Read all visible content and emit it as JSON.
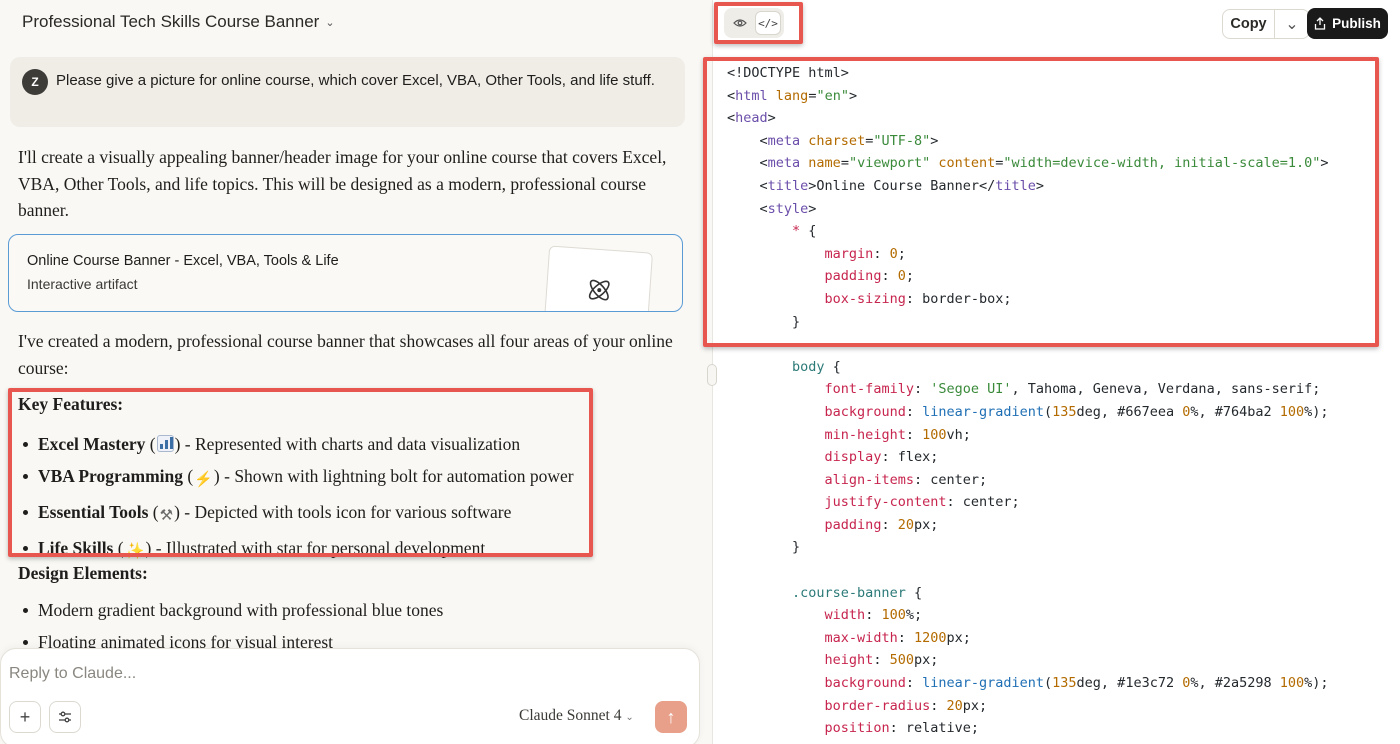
{
  "chat": {
    "title": "Professional Tech Skills Course Banner",
    "user_initial": "Z",
    "user_message": "Please give a picture for online course, which cover Excel, VBA, Other Tools, and life stuff.",
    "intro": "I'll create a visually appealing banner/header image for your online course that covers Excel, VBA, Other Tools, and life topics. This will be designed as a modern, professional course banner.",
    "artifact": {
      "title": "Online Course Banner - Excel, VBA, Tools & Life",
      "subtitle": "Interactive artifact",
      "icon": "atom-icon"
    },
    "summary": "I've created a modern, professional course banner that showcases all four areas of your online course:",
    "key_features_heading": "Key Features:",
    "features": [
      {
        "name": "Excel Mastery",
        "open": " (",
        "icon": "bar-chart-emoji",
        "rest": ") - Represented with charts and data visualization"
      },
      {
        "name": "VBA Programming",
        "open": " (",
        "icon": "lightning-emoji",
        "glyph": "⚡",
        "rest": ") - Shown with lightning bolt for automation power"
      },
      {
        "name": "Essential Tools",
        "open": " (",
        "icon": "tools-emoji",
        "glyph": "⚒",
        "rest": ") - Depicted with tools icon for various software"
      },
      {
        "name": "Life Skills",
        "open": " (",
        "icon": "star-emoji",
        "glyph": "✨",
        "rest": ") - Illustrated with star for personal development"
      }
    ],
    "design_heading": "Design Elements:",
    "design_items": [
      "Modern gradient background with professional blue tones",
      "Floating animated icons for visual interest"
    ],
    "reply_placeholder": "Reply to Claude...",
    "model_name": "Claude",
    "model_version": "Sonnet 4"
  },
  "artifact_panel": {
    "copy_label": "Copy",
    "publish_label": "Publish",
    "highlight_color": "#e8574f",
    "code_lines": [
      [
        [
          "c-punc",
          "<!DOCTYPE html>"
        ]
      ],
      [
        [
          "c-punc",
          "<"
        ],
        [
          "c-tag",
          "html"
        ],
        [
          "c-punc",
          " "
        ],
        [
          "c-attr",
          "lang"
        ],
        [
          "c-punc",
          "="
        ],
        [
          "c-str",
          "\"en\""
        ],
        [
          "c-punc",
          ">"
        ]
      ],
      [
        [
          "c-punc",
          "<"
        ],
        [
          "c-tag",
          "head"
        ],
        [
          "c-punc",
          ">"
        ]
      ],
      [
        [
          "c-punc",
          "    <"
        ],
        [
          "c-tag",
          "meta"
        ],
        [
          "c-punc",
          " "
        ],
        [
          "c-attr",
          "charset"
        ],
        [
          "c-punc",
          "="
        ],
        [
          "c-str",
          "\"UTF-8\""
        ],
        [
          "c-punc",
          ">"
        ]
      ],
      [
        [
          "c-punc",
          "    <"
        ],
        [
          "c-tag",
          "meta"
        ],
        [
          "c-punc",
          " "
        ],
        [
          "c-attr",
          "name"
        ],
        [
          "c-punc",
          "="
        ],
        [
          "c-str",
          "\"viewport\""
        ],
        [
          "c-punc",
          " "
        ],
        [
          "c-attr",
          "content"
        ],
        [
          "c-punc",
          "="
        ],
        [
          "c-str",
          "\"width=device-width, initial-scale=1.0\""
        ],
        [
          "c-punc",
          ">"
        ]
      ],
      [
        [
          "c-punc",
          "    <"
        ],
        [
          "c-tag",
          "title"
        ],
        [
          "c-punc",
          ">Online Course Banner</"
        ],
        [
          "c-tag",
          "title"
        ],
        [
          "c-punc",
          ">"
        ]
      ],
      [
        [
          "c-punc",
          "    <"
        ],
        [
          "c-tag",
          "style"
        ],
        [
          "c-punc",
          ">"
        ]
      ],
      [
        [
          "c-punc",
          "        "
        ],
        [
          "c-prop",
          "*"
        ],
        [
          "c-punc",
          " {"
        ]
      ],
      [
        [
          "c-punc",
          "            "
        ],
        [
          "c-prop",
          "margin"
        ],
        [
          "c-punc",
          ": "
        ],
        [
          "c-num",
          "0"
        ],
        [
          "c-punc",
          ";"
        ]
      ],
      [
        [
          "c-punc",
          "            "
        ],
        [
          "c-prop",
          "padding"
        ],
        [
          "c-punc",
          ": "
        ],
        [
          "c-num",
          "0"
        ],
        [
          "c-punc",
          ";"
        ]
      ],
      [
        [
          "c-punc",
          "            "
        ],
        [
          "c-prop",
          "box-sizing"
        ],
        [
          "c-punc",
          ": border-box;"
        ]
      ],
      [
        [
          "c-punc",
          "        }"
        ]
      ],
      [
        [
          "c-punc",
          ""
        ]
      ],
      [
        [
          "c-punc",
          "        "
        ],
        [
          "c-sel",
          "body"
        ],
        [
          "c-punc",
          " {"
        ]
      ],
      [
        [
          "c-punc",
          "            "
        ],
        [
          "c-prop",
          "font-family"
        ],
        [
          "c-punc",
          ": "
        ],
        [
          "c-str",
          "'Segoe UI'"
        ],
        [
          "c-punc",
          ", Tahoma, Geneva, Verdana, sans-serif;"
        ]
      ],
      [
        [
          "c-punc",
          "            "
        ],
        [
          "c-prop",
          "background"
        ],
        [
          "c-punc",
          ": "
        ],
        [
          "c-fn",
          "linear-gradient"
        ],
        [
          "c-punc",
          "("
        ],
        [
          "c-num",
          "135"
        ],
        [
          "c-punc",
          "deg, #667eea "
        ],
        [
          "c-num",
          "0"
        ],
        [
          "c-punc",
          "%, #764ba2 "
        ],
        [
          "c-num",
          "100"
        ],
        [
          "c-punc",
          "%);"
        ]
      ],
      [
        [
          "c-punc",
          "            "
        ],
        [
          "c-prop",
          "min-height"
        ],
        [
          "c-punc",
          ": "
        ],
        [
          "c-num",
          "100"
        ],
        [
          "c-punc",
          "vh;"
        ]
      ],
      [
        [
          "c-punc",
          "            "
        ],
        [
          "c-prop",
          "display"
        ],
        [
          "c-punc",
          ": flex;"
        ]
      ],
      [
        [
          "c-punc",
          "            "
        ],
        [
          "c-prop",
          "align-items"
        ],
        [
          "c-punc",
          ": center;"
        ]
      ],
      [
        [
          "c-punc",
          "            "
        ],
        [
          "c-prop",
          "justify-content"
        ],
        [
          "c-punc",
          ": center;"
        ]
      ],
      [
        [
          "c-punc",
          "            "
        ],
        [
          "c-prop",
          "padding"
        ],
        [
          "c-punc",
          ": "
        ],
        [
          "c-num",
          "20"
        ],
        [
          "c-punc",
          "px;"
        ]
      ],
      [
        [
          "c-punc",
          "        }"
        ]
      ],
      [
        [
          "c-punc",
          ""
        ]
      ],
      [
        [
          "c-punc",
          "        "
        ],
        [
          "c-sel",
          ".course-banner"
        ],
        [
          "c-punc",
          " {"
        ]
      ],
      [
        [
          "c-punc",
          "            "
        ],
        [
          "c-prop",
          "width"
        ],
        [
          "c-punc",
          ": "
        ],
        [
          "c-num",
          "100"
        ],
        [
          "c-punc",
          "%;"
        ]
      ],
      [
        [
          "c-punc",
          "            "
        ],
        [
          "c-prop",
          "max-width"
        ],
        [
          "c-punc",
          ": "
        ],
        [
          "c-num",
          "1200"
        ],
        [
          "c-punc",
          "px;"
        ]
      ],
      [
        [
          "c-punc",
          "            "
        ],
        [
          "c-prop",
          "height"
        ],
        [
          "c-punc",
          ": "
        ],
        [
          "c-num",
          "500"
        ],
        [
          "c-punc",
          "px;"
        ]
      ],
      [
        [
          "c-punc",
          "            "
        ],
        [
          "c-prop",
          "background"
        ],
        [
          "c-punc",
          ": "
        ],
        [
          "c-fn",
          "linear-gradient"
        ],
        [
          "c-punc",
          "("
        ],
        [
          "c-num",
          "135"
        ],
        [
          "c-punc",
          "deg, #1e3c72 "
        ],
        [
          "c-num",
          "0"
        ],
        [
          "c-punc",
          "%, #2a5298 "
        ],
        [
          "c-num",
          "100"
        ],
        [
          "c-punc",
          "%);"
        ]
      ],
      [
        [
          "c-punc",
          "            "
        ],
        [
          "c-prop",
          "border-radius"
        ],
        [
          "c-punc",
          ": "
        ],
        [
          "c-num",
          "20"
        ],
        [
          "c-punc",
          "px;"
        ]
      ],
      [
        [
          "c-punc",
          "            "
        ],
        [
          "c-prop",
          "position"
        ],
        [
          "c-punc",
          ": relative;"
        ]
      ]
    ]
  }
}
